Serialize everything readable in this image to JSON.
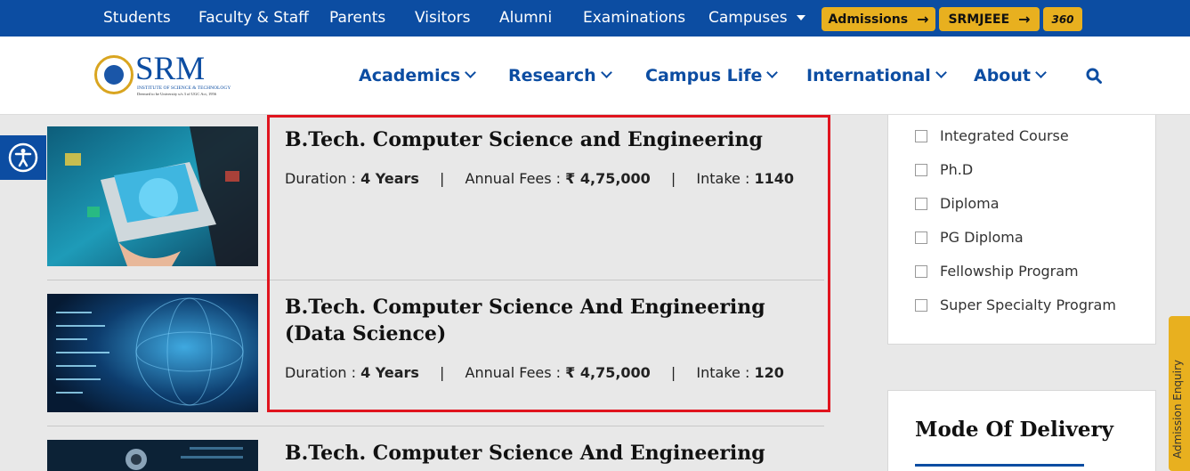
{
  "topbar": {
    "links": [
      "Students",
      "Faculty & Staff",
      "Parents",
      "Visitors",
      "Alumni",
      "Examinations",
      "Campuses"
    ],
    "admissions_label": "Admissions",
    "srmjeee_label": "SRMJEEE",
    "tour_label": "360"
  },
  "header": {
    "logo_name": "SRM",
    "logo_sub": "INSTITUTE OF SCIENCE & TECHNOLOGY",
    "logo_sub2": "Deemed to be University u/s 3 of UGC Act, 1956",
    "nav": [
      "Academics",
      "Research",
      "Campus Life",
      "International",
      "About"
    ]
  },
  "courses": [
    {
      "title": "B.Tech. Computer Science and Engineering",
      "duration_label": "Duration :",
      "duration": "4 Years",
      "fees_label": "Annual Fees :",
      "fees": "₹ 4,75,000",
      "intake_label": "Intake :",
      "intake": "1140"
    },
    {
      "title": "B.Tech. Computer Science And Engineering (Data Science)",
      "duration_label": "Duration :",
      "duration": "4 Years",
      "fees_label": "Annual Fees :",
      "fees": "₹ 4,75,000",
      "intake_label": "Intake :",
      "intake": "120"
    },
    {
      "title": "B.Tech. Computer Science And Engineering with"
    }
  ],
  "sidebar": {
    "programs": [
      "Integrated Course",
      "Ph.D",
      "Diploma",
      "PG Diploma",
      "Fellowship Program",
      "Super Specialty Program"
    ],
    "mode_title": "Mode Of Delivery",
    "enquiry_label": "Admission Enquiry"
  },
  "colors": {
    "brand_blue": "#0c4da2",
    "accent_yellow": "#e8b01f",
    "highlight_red": "#e0141e"
  },
  "icons": {
    "search": "search-icon",
    "accessibility": "accessibility-icon",
    "arrow": "arrow-right-icon"
  }
}
